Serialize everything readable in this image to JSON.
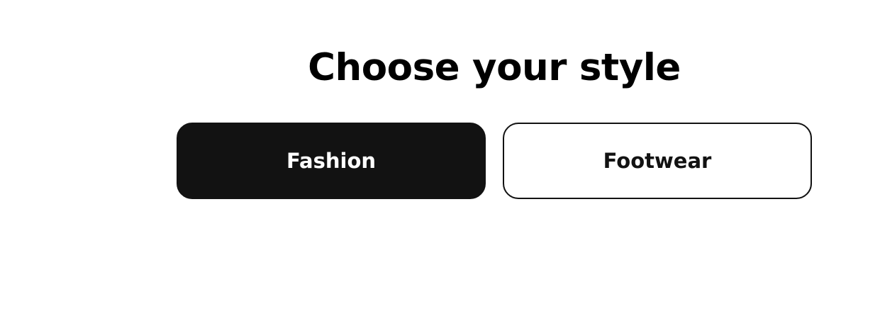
{
  "page": {
    "title": "Choose your style"
  },
  "options": [
    {
      "label": "Fashion",
      "selected": true
    },
    {
      "label": "Footwear",
      "selected": false
    }
  ],
  "colors": {
    "background": "#ffffff",
    "selected_fill": "#121212",
    "selected_text": "#ffffff",
    "unselected_border": "#121212",
    "unselected_text": "#121212"
  }
}
